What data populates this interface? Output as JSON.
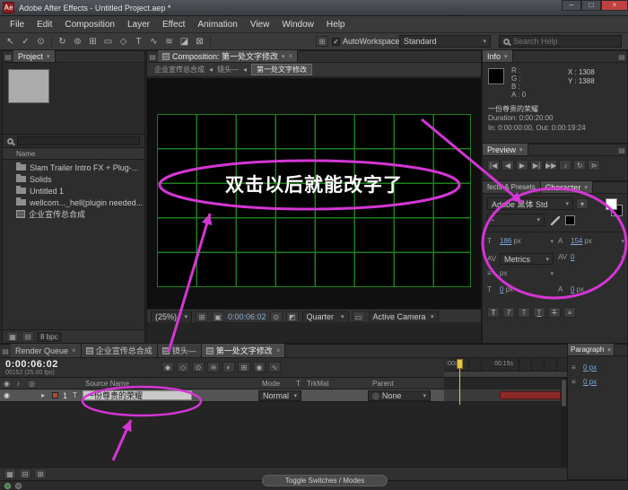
{
  "colors": {
    "annotation": "#d336d3",
    "grid_green": "#1e7e1e",
    "value_blue": "#7ea8d8"
  },
  "titlebar": {
    "icon": "Ae",
    "title": "Adobe After Effects - Untitled Project.aep *",
    "minimize": "–",
    "maximize": "□",
    "close": "×"
  },
  "menubar": {
    "items": [
      "File",
      "Edit",
      "Composition",
      "Layer",
      "Effect",
      "Animation",
      "View",
      "Window",
      "Help"
    ]
  },
  "toolbar": {
    "autoworkspace": "AutoWorkspace:",
    "workspace": "Standard",
    "search_placeholder": "Search Help",
    "checkmark": "✓"
  },
  "project": {
    "tab": "Project",
    "name_col": "Name",
    "items": [
      {
        "label": "Slam Trailer Intro FX + Plug-..."
      },
      {
        "label": "Solids"
      },
      {
        "label": "Untitled 1"
      },
      {
        "label": "wellcom..._hell(plugin needed..."
      },
      {
        "label": "企业宣传总合成"
      }
    ],
    "bpc": "8 bpc"
  },
  "comp": {
    "tab": "Composition: 第一处文字修改",
    "breadcrumb": [
      "企业宣传总合成",
      "镜头—",
      "第一处文字修改"
    ],
    "canvas_text": "双击以后就能改字了",
    "zoom": "(25%)",
    "timecode": "0:00:06:02",
    "resolution": "Quarter",
    "view": "Active Camera"
  },
  "info": {
    "tab": "Info",
    "r": "R :",
    "g": "G :",
    "b": "B :",
    "a": "A : 0",
    "x": "X : 1308",
    "y": "Y : 1388",
    "line1": "一份尊贵的荣耀",
    "line2": "Duration: 0:00:20:00",
    "line3": "In: 0:00:00:00, Out: 0:00:19:24"
  },
  "preview": {
    "tab": "Preview"
  },
  "character": {
    "tab_left": "fects & Presets",
    "tab": "Character",
    "font": "Adobe 黑体 Std",
    "style": "-",
    "font_size": "186",
    "font_size_unit": "px",
    "leading": "154",
    "leading_unit": "px",
    "kerning": "Metrics",
    "tracking": "0",
    "stroke_width_unit": "px",
    "vertical_scale": "0",
    "vertical_scale_unit": "px",
    "baseline_shift": "0",
    "baseline_shift_unit": "px",
    "faux": "T"
  },
  "paragraph": {
    "tab": "Paragraph",
    "indent_left": "0 px",
    "indent_right": "0 px"
  },
  "timeline": {
    "tabs": [
      {
        "label": "Render Queue"
      },
      {
        "label": "企业宣传总合成"
      },
      {
        "label": "镜头—"
      },
      {
        "label": "第一处文字修改"
      }
    ],
    "timecode": "0:00:06:02",
    "frames": "00152 (25.00 fps)",
    "cols": {
      "source": "Source Name",
      "mode": "Mode",
      "t": "T",
      "trkmat": "TrkMat",
      "parent": "Parent"
    },
    "layer": {
      "index": "1",
      "name": "一份尊贵的荣耀",
      "mode": "Normal",
      "parent": "None"
    },
    "ruler": {
      "t0": ":00s",
      "t1": "00:15s"
    },
    "toggle": "Toggle Switches / Modes"
  }
}
